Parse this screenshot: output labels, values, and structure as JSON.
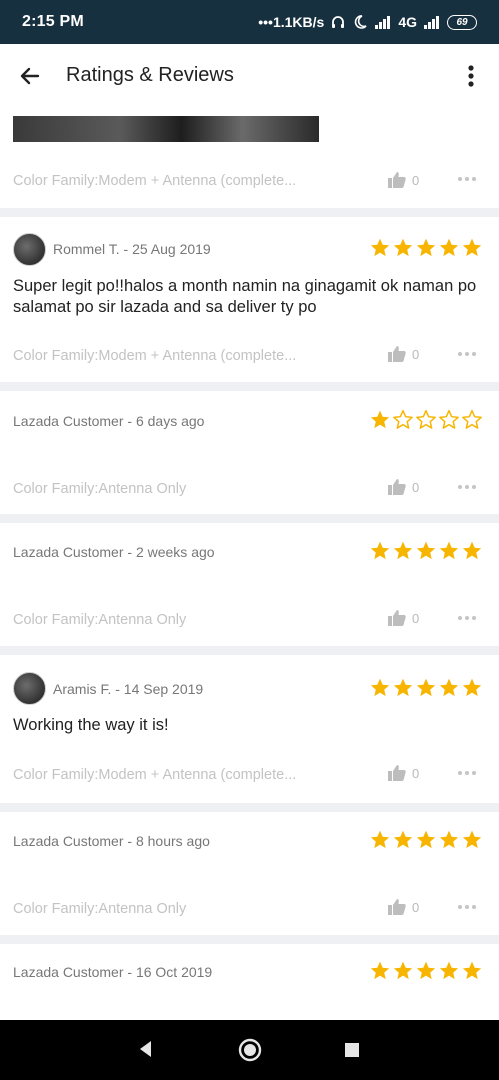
{
  "status_bar": {
    "time": "2:15 PM",
    "net_speed": "1.1KB/s",
    "network_type": "4G",
    "battery": "69"
  },
  "app_bar": {
    "title": "Ratings & Reviews",
    "back_icon": "arrow-left-icon",
    "menu_icon": "more-vertical-icon"
  },
  "colors": {
    "star_filled": "#f7b500",
    "status_bar_bg": "#17303f",
    "separator": "#eef0f4",
    "muted_text": "#c3c3c3"
  },
  "reviews": [
    {
      "sku": "Color Family:Modem + Antenna (complete...",
      "likes": "0"
    },
    {
      "reviewer": "Rommel T. - 25 Aug 2019",
      "rating": 5,
      "text": "Super legit po!!halos a month namin na ginagamit ok naman po salamat po sir lazada and sa deliver ty po",
      "sku": "Color Family:Modem + Antenna (complete...",
      "likes": "0"
    },
    {
      "reviewer": "Lazada Customer - 6  days ago",
      "rating": 1,
      "sku": "Color Family:Antenna Only",
      "likes": "0"
    },
    {
      "reviewer": "Lazada Customer - 2  weeks ago",
      "rating": 5,
      "sku": "Color Family:Antenna Only",
      "likes": "0"
    },
    {
      "reviewer": "Aramis F. - 14 Sep 2019",
      "rating": 5,
      "text": "Working the way it is!",
      "sku": "Color Family:Modem + Antenna (complete...",
      "likes": "0"
    },
    {
      "reviewer": "Lazada Customer - 8  hours ago",
      "rating": 5,
      "sku": "Color Family:Antenna Only",
      "likes": "0"
    },
    {
      "reviewer": "Lazada Customer - 16 Oct 2019",
      "rating": 5
    }
  ]
}
